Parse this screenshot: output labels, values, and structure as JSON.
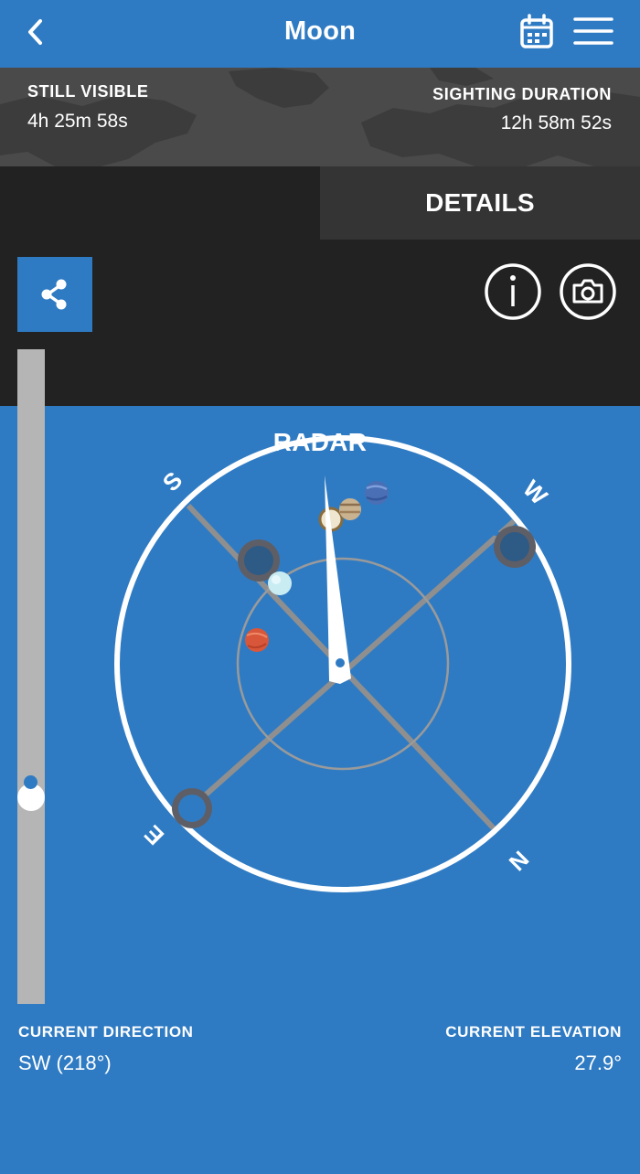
{
  "header": {
    "title": "Moon",
    "back_icon": "chevron-left-icon",
    "calendar_icon": "calendar-icon",
    "menu_icon": "hamburger-menu-icon"
  },
  "info": {
    "still_visible_label": "STILL VISIBLE",
    "still_visible_value": "4h 25m 58s",
    "sighting_duration_label": "SIGHTING DURATION",
    "sighting_duration_value": "12h 58m 52s"
  },
  "tabs": [
    {
      "label": "RADAR",
      "active": true
    },
    {
      "label": "DETAILS",
      "active": false
    }
  ],
  "toolbar": {
    "share_icon": "share-icon",
    "info_icon": "info-icon",
    "camera_icon": "camera-icon"
  },
  "radar": {
    "compass_labels": {
      "south": "S",
      "west": "W",
      "east": "E",
      "north": "N"
    },
    "track_color": "#2f7bc3"
  },
  "elevation_slider": {
    "current_elevation_deg": 27.9
  },
  "footer": {
    "direction_label": "CURRENT DIRECTION",
    "direction_value": "SW (218°)",
    "elevation_label": "CURRENT ELEVATION",
    "elevation_value": "27.9°"
  },
  "colors": {
    "accent": "#2f7bc3",
    "background": "#222222",
    "tab_inactive": "#343434"
  }
}
